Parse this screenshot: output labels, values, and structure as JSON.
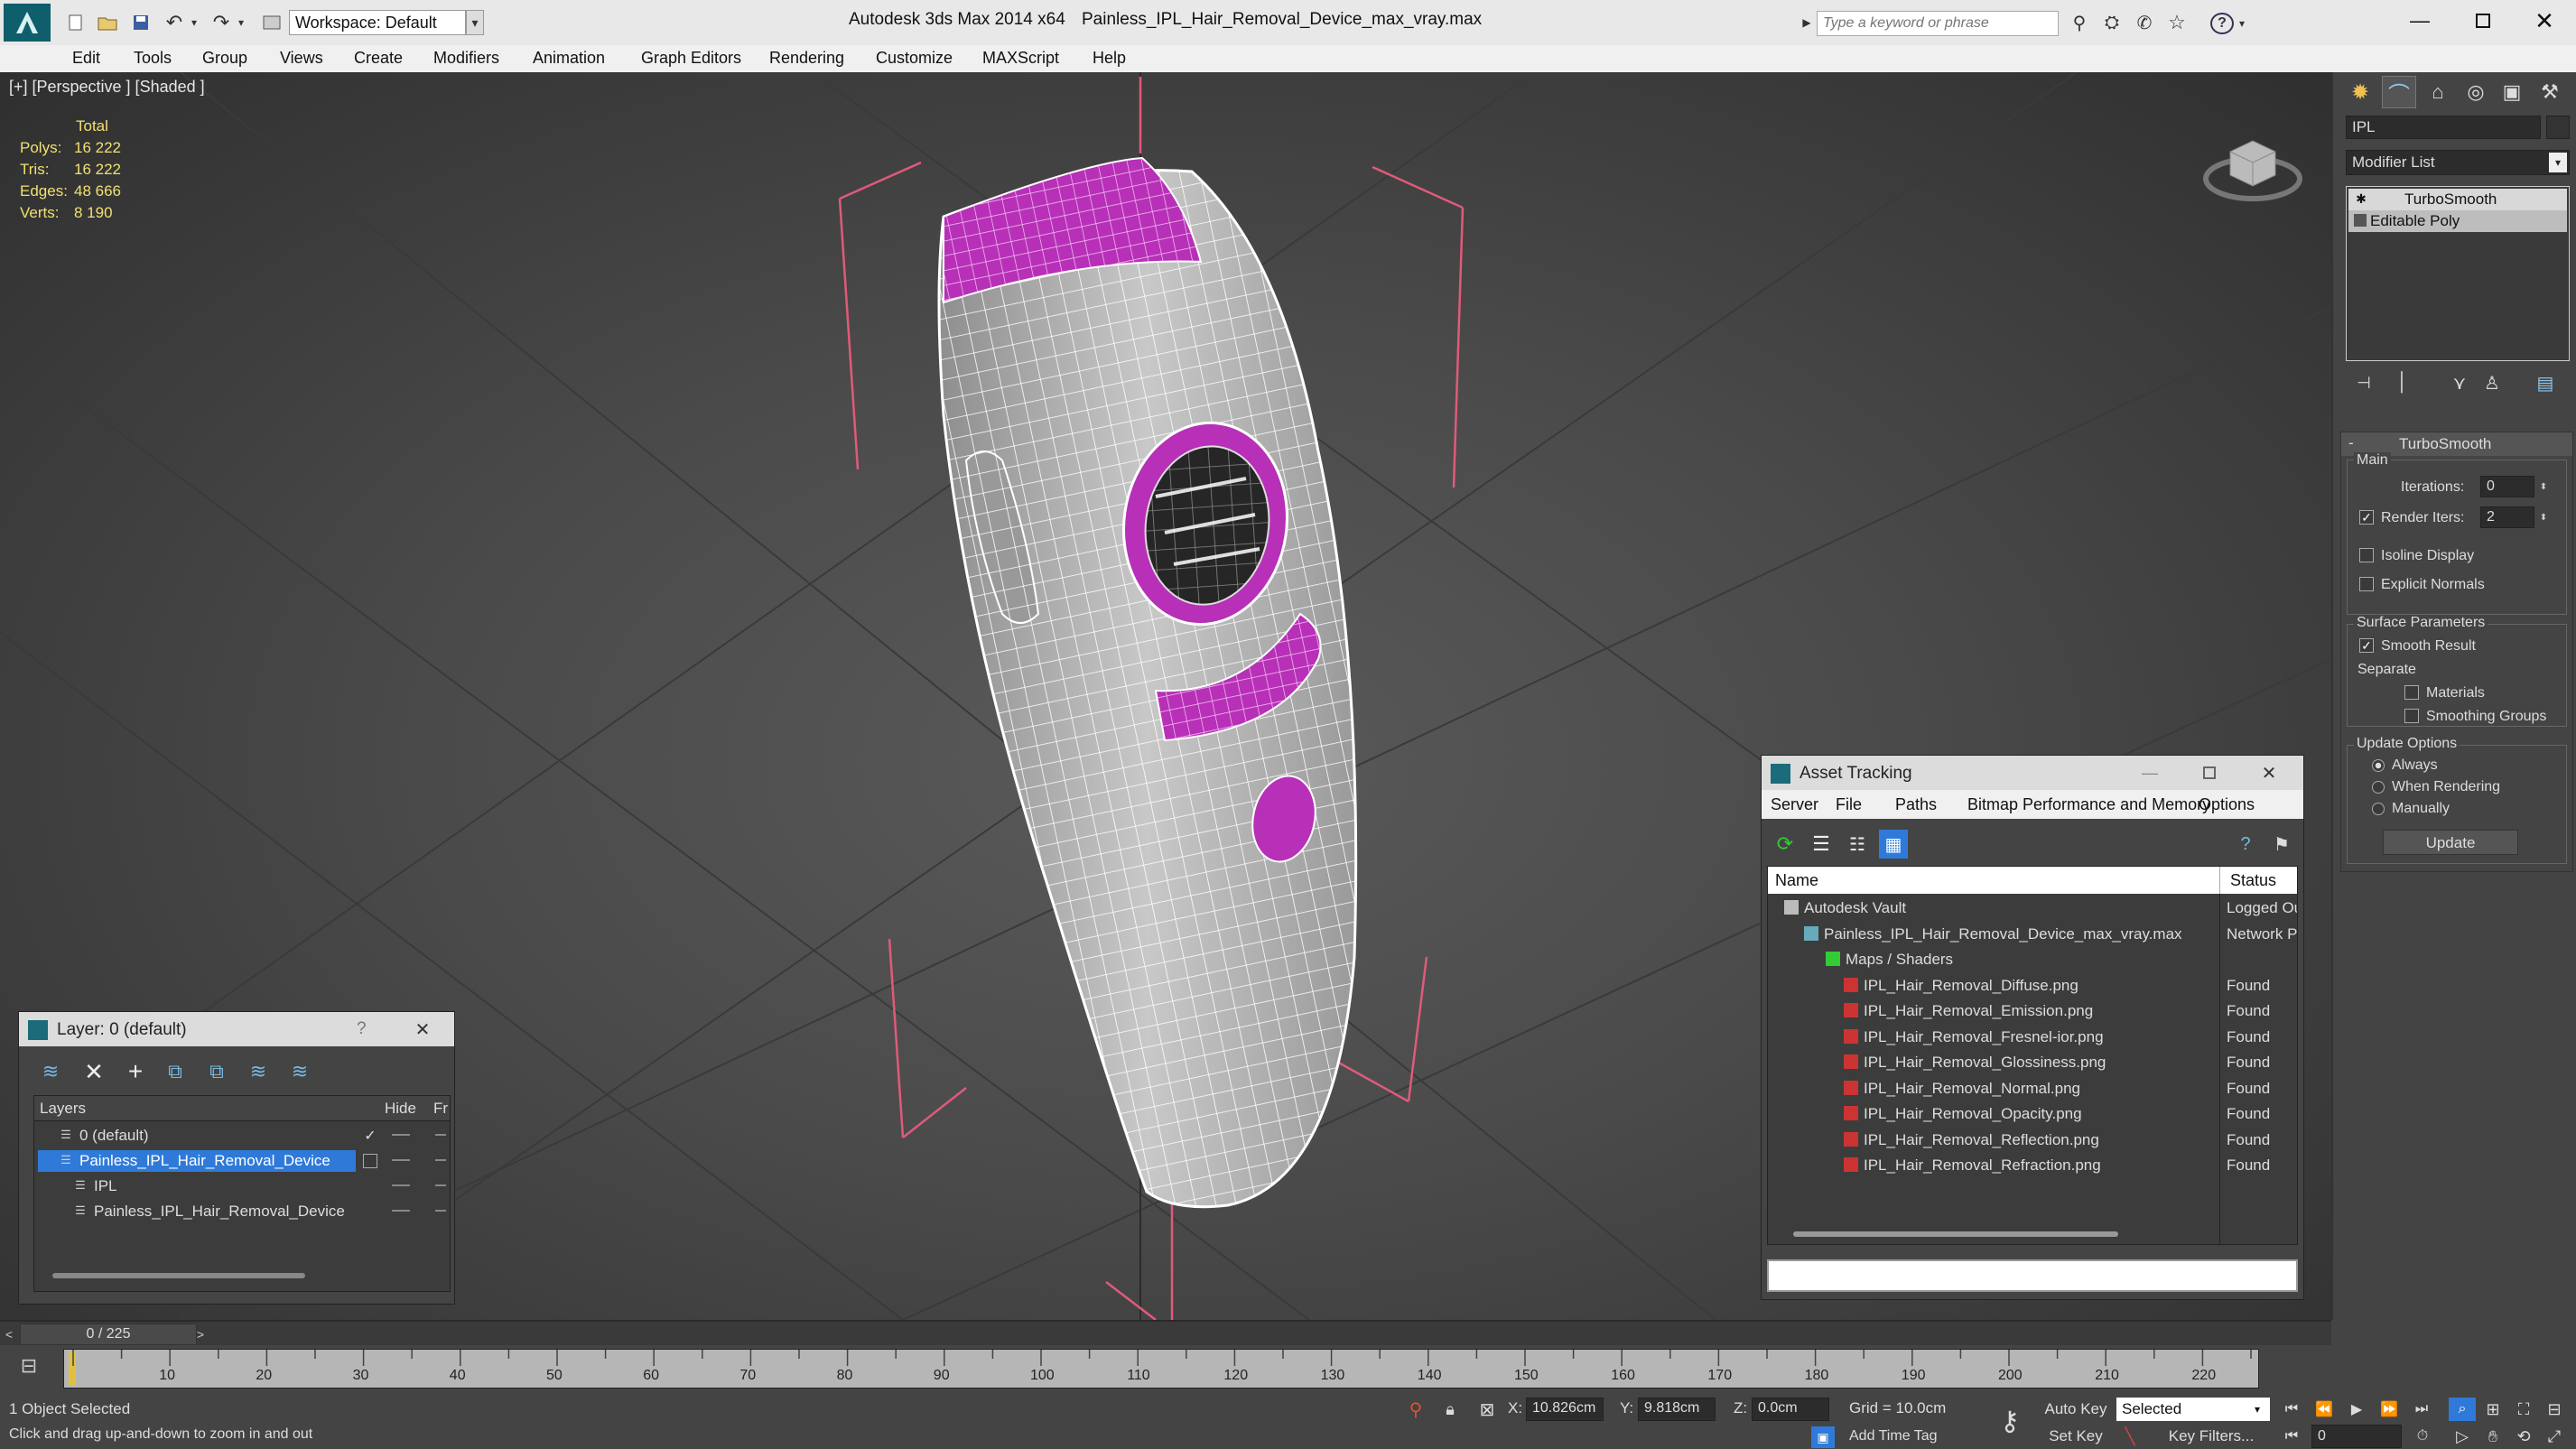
{
  "titlebar": {
    "workspace_label": "Workspace: Default",
    "app_name": "Autodesk 3ds Max  2014 x64",
    "file_name": "Painless_IPL_Hair_Removal_Device_max_vray.max",
    "search_placeholder": "Type a keyword or phrase"
  },
  "menu": [
    "Edit",
    "Tools",
    "Group",
    "Views",
    "Create",
    "Modifiers",
    "Animation",
    "Graph Editors",
    "Rendering",
    "Customize",
    "MAXScript",
    "Help"
  ],
  "viewport": {
    "label": "[+] [Perspective ] [Shaded ]",
    "stats_header": "Total",
    "stats": [
      {
        "label": "Polys:",
        "value": "16 222"
      },
      {
        "label": "Tris:",
        "value": "16 222"
      },
      {
        "label": "Edges:",
        "value": "48 666"
      },
      {
        "label": "Verts:",
        "value": "8 190"
      }
    ],
    "accent_color": "#cc33cc"
  },
  "cmdpanel": {
    "object_name": "IPL",
    "modifier_list_label": "Modifier List",
    "stack": [
      "TurboSmooth",
      "Editable Poly"
    ],
    "rollout_title": "TurboSmooth",
    "main_label": "Main",
    "iterations_label": "Iterations:",
    "iterations_value": "0",
    "render_iters_label": "Render Iters:",
    "render_iters_value": "2",
    "isoline_label": "Isoline Display",
    "explicit_normals_label": "Explicit Normals",
    "surface_label": "Surface Parameters",
    "smooth_result_label": "Smooth Result",
    "separate_label": "Separate",
    "materials_label": "Materials",
    "smoothing_groups_label": "Smoothing Groups",
    "update_options_label": "Update Options",
    "always_label": "Always",
    "when_rendering_label": "When Rendering",
    "manually_label": "Manually",
    "update_button": "Update"
  },
  "asset_tracking": {
    "title": "Asset Tracking",
    "menu": [
      "Server",
      "File",
      "Paths",
      "Bitmap Performance and Memory",
      "Options"
    ],
    "col_name": "Name",
    "col_status": "Status",
    "rows": [
      {
        "name": "Autodesk Vault",
        "status": "Logged Ou",
        "indent": 0
      },
      {
        "name": "Painless_IPL_Hair_Removal_Device_max_vray.max",
        "status": "Network P",
        "indent": 1
      },
      {
        "name": "Maps / Shaders",
        "status": "",
        "indent": 2
      },
      {
        "name": "IPL_Hair_Removal_Diffuse.png",
        "status": "Found",
        "indent": 3
      },
      {
        "name": "IPL_Hair_Removal_Emission.png",
        "status": "Found",
        "indent": 3
      },
      {
        "name": "IPL_Hair_Removal_Fresnel-ior.png",
        "status": "Found",
        "indent": 3
      },
      {
        "name": "IPL_Hair_Removal_Glossiness.png",
        "status": "Found",
        "indent": 3
      },
      {
        "name": "IPL_Hair_Removal_Normal.png",
        "status": "Found",
        "indent": 3
      },
      {
        "name": "IPL_Hair_Removal_Opacity.png",
        "status": "Found",
        "indent": 3
      },
      {
        "name": "IPL_Hair_Removal_Reflection.png",
        "status": "Found",
        "indent": 3
      },
      {
        "name": "IPL_Hair_Removal_Refraction.png",
        "status": "Found",
        "indent": 3
      }
    ]
  },
  "layer_window": {
    "title": "Layer: 0 (default)",
    "help": "?",
    "col_layers": "Layers",
    "col_hide": "Hide",
    "col_fr": "Fr",
    "rows": [
      {
        "name": "0 (default)",
        "indent": 0,
        "selected": false
      },
      {
        "name": "Painless_IPL_Hair_Removal_Device",
        "indent": 0,
        "selected": true
      },
      {
        "name": "IPL",
        "indent": 1,
        "selected": false
      },
      {
        "name": "Painless_IPL_Hair_Removal_Device",
        "indent": 1,
        "selected": false
      }
    ]
  },
  "timeline": {
    "frame_counter": "0 / 225",
    "ticks": [
      "10",
      "20",
      "30",
      "40",
      "50",
      "60",
      "70",
      "80",
      "90",
      "100",
      "110",
      "120",
      "130",
      "140",
      "150",
      "160",
      "170",
      "180",
      "190",
      "200",
      "210",
      "220"
    ],
    "status": "1 Object Selected",
    "prompt": "Click and drag up-and-down to zoom in and out",
    "x_label": "X:",
    "x_value": "10.826cm",
    "y_label": "Y:",
    "y_value": "9.818cm",
    "z_label": "Z:",
    "z_value": "0.0cm",
    "grid": "Grid = 10.0cm",
    "auto_key": "Auto Key",
    "selected_dropdown": "Selected",
    "set_key": "Set Key",
    "key_filters": "Key Filters...",
    "add_time_tag": "Add Time Tag",
    "frame_value": "0"
  }
}
